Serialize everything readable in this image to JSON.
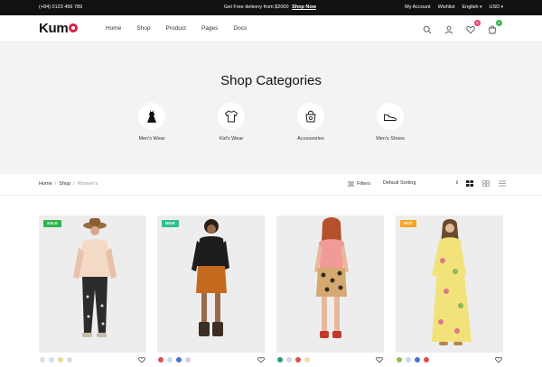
{
  "topbar": {
    "phone": "(+84) 0123 456 789",
    "promo_text": "Get Free delivery from $2000",
    "promo_link": "Shop Now",
    "account": "My Account",
    "wishlist": "Wishlist",
    "language": "English",
    "currency": "USD"
  },
  "header": {
    "logo": "Kum",
    "nav": [
      "Home",
      "Shop",
      "Product",
      "Pages",
      "Docs"
    ],
    "wishlist_count": "0",
    "cart_count": "0",
    "wishlist_badge_color": "#e8436a",
    "cart_badge_color": "#2fb34b"
  },
  "hero": {
    "title": "Shop Categories",
    "categories": [
      {
        "label": "Men's Wear",
        "icon": "dress-icon"
      },
      {
        "label": "Kid's Wear",
        "icon": "tshirt-icon"
      },
      {
        "label": "Accessories",
        "icon": "bag-icon"
      },
      {
        "label": "Men's Shoes",
        "icon": "shoe-icon"
      }
    ]
  },
  "toolbar": {
    "breadcrumb": [
      "Home",
      "Shop",
      "Women's"
    ],
    "filters": "Filters",
    "sort": "Default Sorting"
  },
  "products": [
    {
      "badge": "SALE",
      "badge_color": "#2fb34b",
      "swatches": [
        "#dcdfe6",
        "#d4dbe9",
        "#e9d896",
        "#e8d4d6"
      ]
    },
    {
      "badge": "NEW",
      "badge_color": "#2fbf8a",
      "swatches": [
        "#d9534f",
        "#cdd7e6",
        "#4b74c9",
        "#d9cbe9"
      ]
    },
    {
      "badge": "",
      "badge_color": "",
      "swatches": [
        "#2e9d6f",
        "#cdd7e6",
        "#d9534f",
        "#f0e0a8"
      ]
    },
    {
      "badge": "HOT",
      "badge_color": "#f5a623",
      "swatches": [
        "#8bc34a",
        "#cdd7e6",
        "#4b74c9",
        "#d9534f"
      ]
    }
  ]
}
